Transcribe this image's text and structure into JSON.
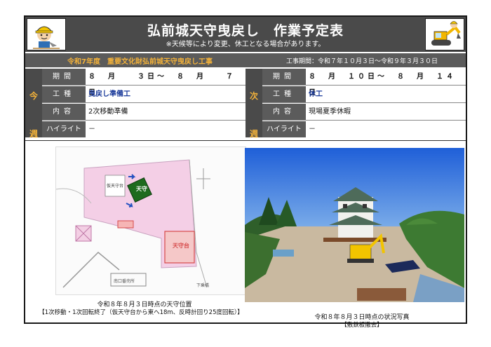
{
  "header": {
    "title": "弘前城天守曳戻し　作業予定表",
    "note": "※天候等により変更、休工となる場合があります。"
  },
  "info": {
    "project": "令和7年度　重要文化財弘前城天守曳戻し工事",
    "term": "工事期間：令和７年１０月３日～令和９年３月３０日"
  },
  "this_week": {
    "side_label": [
      "今",
      "週"
    ],
    "period_label": "期間",
    "period": "８　月　　３日～　８　月　　７　日",
    "work_label": "工種",
    "work": "曳戻し準備工",
    "content_label": "内容",
    "content": "2次移動準備",
    "highlight_label": "ハイライト",
    "highlight": "－"
  },
  "next_week": {
    "side_label": [
      "次",
      "週"
    ],
    "period_label": "期間",
    "period": "８　月　１０日～　８　月　１４　日",
    "work_label": "工種",
    "work": "休工",
    "content_label": "内容",
    "content": "現場夏季休暇",
    "highlight_label": "ハイライト",
    "highlight": "－"
  },
  "map": {
    "label_tenshu": "天守",
    "label_temp": "仮天守台",
    "label_base": "天守台",
    "label_gate": "南口番売所",
    "label_bridge": "下乗橋",
    "caption_line1": "令和８年８月３日時点の天守位置",
    "caption_line2": "【1次移動・1次回転終了（仮天守台から東へ18m、反時計回り25度回転）】"
  },
  "photo": {
    "caption_line1": "令和８年８月３日時点の状況写真",
    "caption_line2": "【敷鉄板撤去】"
  },
  "colors": {
    "dark": "#4a4a4a",
    "accent": "#f3b23a",
    "blue_text": "#1a3a9a"
  }
}
